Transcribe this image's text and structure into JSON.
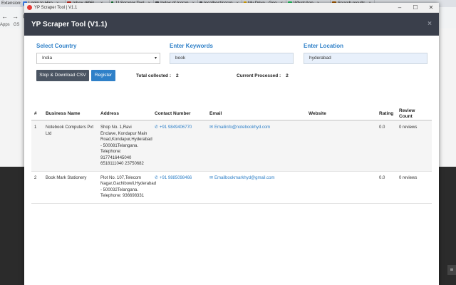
{
  "browser": {
    "tabs": [
      {
        "label": "Extensions",
        "color": "#5f6368"
      },
      {
        "label": "Login to Hire",
        "color": "#4285f4"
      },
      {
        "label": "Inbox (696) -",
        "color": "#d93025"
      },
      {
        "label": "JJ Scraper Tool",
        "color": "#188038"
      },
      {
        "label": "Index of /scrap",
        "color": "#5f6368"
      },
      {
        "label": "localhost/scrap",
        "color": "#5f6368"
      },
      {
        "label": "My Drive - Goo",
        "color": "#fbbc04"
      },
      {
        "label": "WhatsApp",
        "color": "#25d366"
      },
      {
        "label": "Search results",
        "color": "#b06000"
      }
    ],
    "apps_label": "Apps",
    "gs_label": "GS"
  },
  "window": {
    "title": "YP Scraper Tool | V1.1",
    "minimize": "–",
    "maximize": "☐",
    "close": "✕"
  },
  "app": {
    "title": "YP Scraper Tool (V1.1)",
    "close": "×"
  },
  "form": {
    "country_label": "Select Country",
    "country_value": "India",
    "keywords_label": "Enter Keywords",
    "keywords_value": "book",
    "location_label": "Enter Location",
    "location_value": "hyderabad",
    "stop_button": "Stop & Download CSV",
    "register_button": "Register",
    "total_label": "Total collected :",
    "total_value": "2",
    "processed_label": "Current Processed :",
    "processed_value": "2"
  },
  "table": {
    "headers": [
      "#",
      "Business Name",
      "Address",
      "Contact Number",
      "Email",
      "Website",
      "Rating",
      "Review Count"
    ],
    "rows": [
      {
        "num": "1",
        "name": "Notebook Computers Pvt Ltd",
        "address": "Shop No. 1,Ravi Enclave, Kondapur Main Road,Kondapur,Hyderabad - 500081Telangana. Telephone: 9177416445040 6518111040 23750682",
        "contact": "+91 9849406770",
        "email": "Emailinfo@notebookhyd.com",
        "website": "",
        "rating": "0.0",
        "reviews": "0 reviews"
      },
      {
        "num": "2",
        "name": "Book Mark Stationery",
        "address": "Plot No. 107,Telecom Nagar,Gachibowli,Hyderabad - 500032Telangana. Telephone: 936698331",
        "contact": "+91 9885098466",
        "email": "Emailbookmarkhyd@gmail.com",
        "website": "",
        "rating": "0.0",
        "reviews": "0 reviews"
      }
    ]
  },
  "colors": {
    "accent": "#2f80c8",
    "header_bg": "#3a3f4b"
  }
}
